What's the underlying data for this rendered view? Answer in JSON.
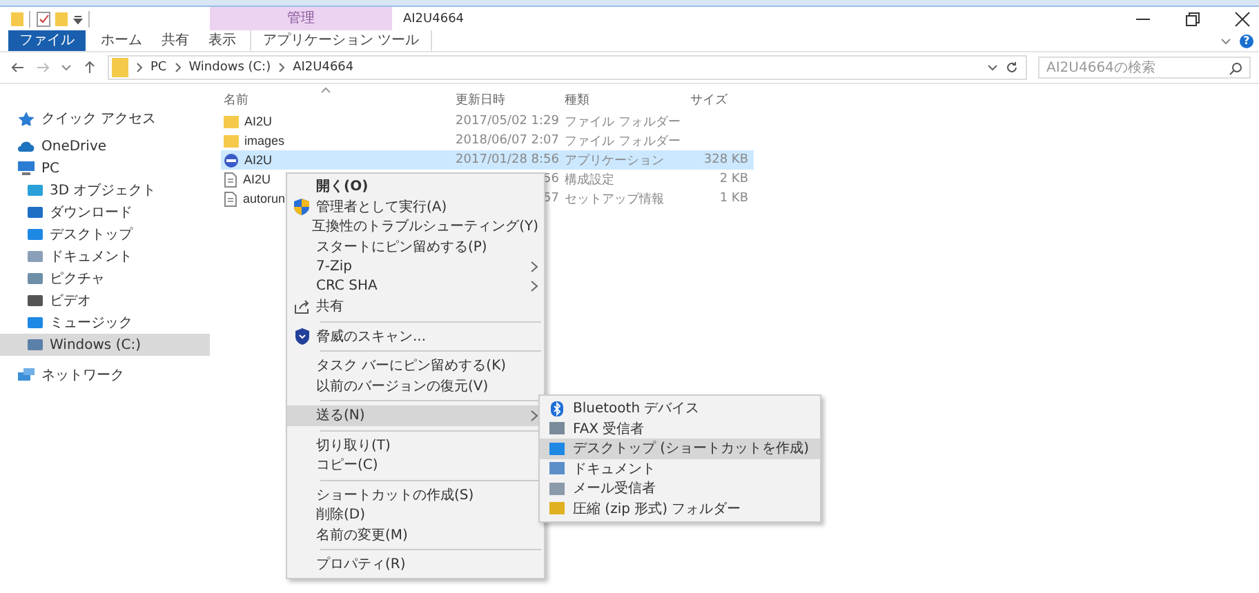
{
  "window": {
    "title": "AI2U4664",
    "context_tab": "管理",
    "help": "?"
  },
  "ribbon_tabs": [
    {
      "label": "ファイル",
      "kind": "file",
      "selected": false
    },
    {
      "label": "ホーム",
      "kind": "tab",
      "selected": false
    },
    {
      "label": "共有",
      "kind": "tab",
      "selected": false
    },
    {
      "label": "表示",
      "kind": "tab",
      "selected": false
    },
    {
      "label": "アプリケーション ツール",
      "kind": "context",
      "selected": false
    }
  ],
  "address": {
    "path": [
      "PC",
      "Windows (C:)",
      "AI2U4664"
    ]
  },
  "search": {
    "placeholder": "AI2U4664の検索"
  },
  "sidebar": {
    "items": [
      {
        "label": "クイック アクセス",
        "selected": false
      },
      {
        "label": "OneDrive",
        "selected": false
      },
      {
        "label": "PC",
        "selected": false,
        "children": [
          {
            "label": "3D オブジェクト",
            "selected": false
          },
          {
            "label": "ダウンロード",
            "selected": false
          },
          {
            "label": "デスクトップ",
            "selected": false
          },
          {
            "label": "ドキュメント",
            "selected": false
          },
          {
            "label": "ピクチャ",
            "selected": false
          },
          {
            "label": "ビデオ",
            "selected": false
          },
          {
            "label": "ミュージック",
            "selected": false
          },
          {
            "label": "Windows (C:)",
            "selected": true
          }
        ]
      },
      {
        "label": "ネットワーク",
        "selected": false
      }
    ]
  },
  "table": {
    "columns": [
      "名前",
      "更新日時",
      "種類",
      "サイズ"
    ],
    "rows": [
      {
        "kind": "folder",
        "name": "AI2U",
        "date": "2017/05/02 1:29",
        "type": "ファイル フォルダー",
        "size": "",
        "selected": false
      },
      {
        "kind": "folder",
        "name": "images",
        "date": "2018/06/07 2:07",
        "type": "ファイル フォルダー",
        "size": "",
        "selected": false
      },
      {
        "kind": "app",
        "name": "AI2U",
        "date": "2017/01/28 8:56",
        "type": "アプリケーション",
        "size": "328 KB",
        "selected": true
      },
      {
        "kind": "doc",
        "name": "AI2U",
        "date": "56",
        "type": "構成設定",
        "size": "2 KB",
        "selected": false
      },
      {
        "kind": "doc",
        "name": "autorun",
        "date": "57",
        "type": "セットアップ情報",
        "size": "1 KB",
        "selected": false
      }
    ]
  },
  "context_menu": {
    "items": [
      {
        "kind": "item",
        "label": "開く(O)",
        "bold": true,
        "submenu": false,
        "selected": false
      },
      {
        "kind": "item",
        "label": "管理者として実行(A)",
        "bold": false,
        "submenu": false,
        "selected": false
      },
      {
        "kind": "item",
        "label": "互換性のトラブルシューティング(Y)",
        "bold": false,
        "submenu": false,
        "selected": false
      },
      {
        "kind": "item",
        "label": "スタートにピン留めする(P)",
        "bold": false,
        "submenu": false,
        "selected": false
      },
      {
        "kind": "item",
        "label": "7-Zip",
        "bold": false,
        "submenu": true,
        "selected": false
      },
      {
        "kind": "item",
        "label": "CRC SHA",
        "bold": false,
        "submenu": true,
        "selected": false
      },
      {
        "kind": "item",
        "label": "共有",
        "bold": false,
        "submenu": false,
        "selected": false
      },
      {
        "kind": "separator"
      },
      {
        "kind": "item",
        "label": "脅威のスキャン...",
        "bold": false,
        "submenu": false,
        "selected": false
      },
      {
        "kind": "separator"
      },
      {
        "kind": "item",
        "label": "タスク バーにピン留めする(K)",
        "bold": false,
        "submenu": false,
        "selected": false
      },
      {
        "kind": "item",
        "label": "以前のバージョンの復元(V)",
        "bold": false,
        "submenu": false,
        "selected": false
      },
      {
        "kind": "separator"
      },
      {
        "kind": "item",
        "label": "送る(N)",
        "bold": false,
        "submenu": true,
        "selected": true
      },
      {
        "kind": "separator"
      },
      {
        "kind": "item",
        "label": "切り取り(T)",
        "bold": false,
        "submenu": false,
        "selected": false
      },
      {
        "kind": "item",
        "label": "コピー(C)",
        "bold": false,
        "submenu": false,
        "selected": false
      },
      {
        "kind": "separator"
      },
      {
        "kind": "item",
        "label": "ショートカットの作成(S)",
        "bold": false,
        "submenu": false,
        "selected": false
      },
      {
        "kind": "item",
        "label": "削除(D)",
        "bold": false,
        "submenu": false,
        "selected": false
      },
      {
        "kind": "item",
        "label": "名前の変更(M)",
        "bold": false,
        "submenu": false,
        "selected": false
      },
      {
        "kind": "separator"
      },
      {
        "kind": "item",
        "label": "プロパティ(R)",
        "bold": false,
        "submenu": false,
        "selected": false
      }
    ]
  },
  "send_to_menu": {
    "items": [
      {
        "label": "Bluetooth デバイス",
        "selected": false
      },
      {
        "label": "FAX 受信者",
        "selected": false
      },
      {
        "label": "デスクトップ (ショートカットを作成)",
        "selected": true
      },
      {
        "label": "ドキュメント",
        "selected": false
      },
      {
        "label": "メール受信者",
        "selected": false
      },
      {
        "label": "圧縮 (zip 形式) フォルダー",
        "selected": false
      }
    ]
  }
}
